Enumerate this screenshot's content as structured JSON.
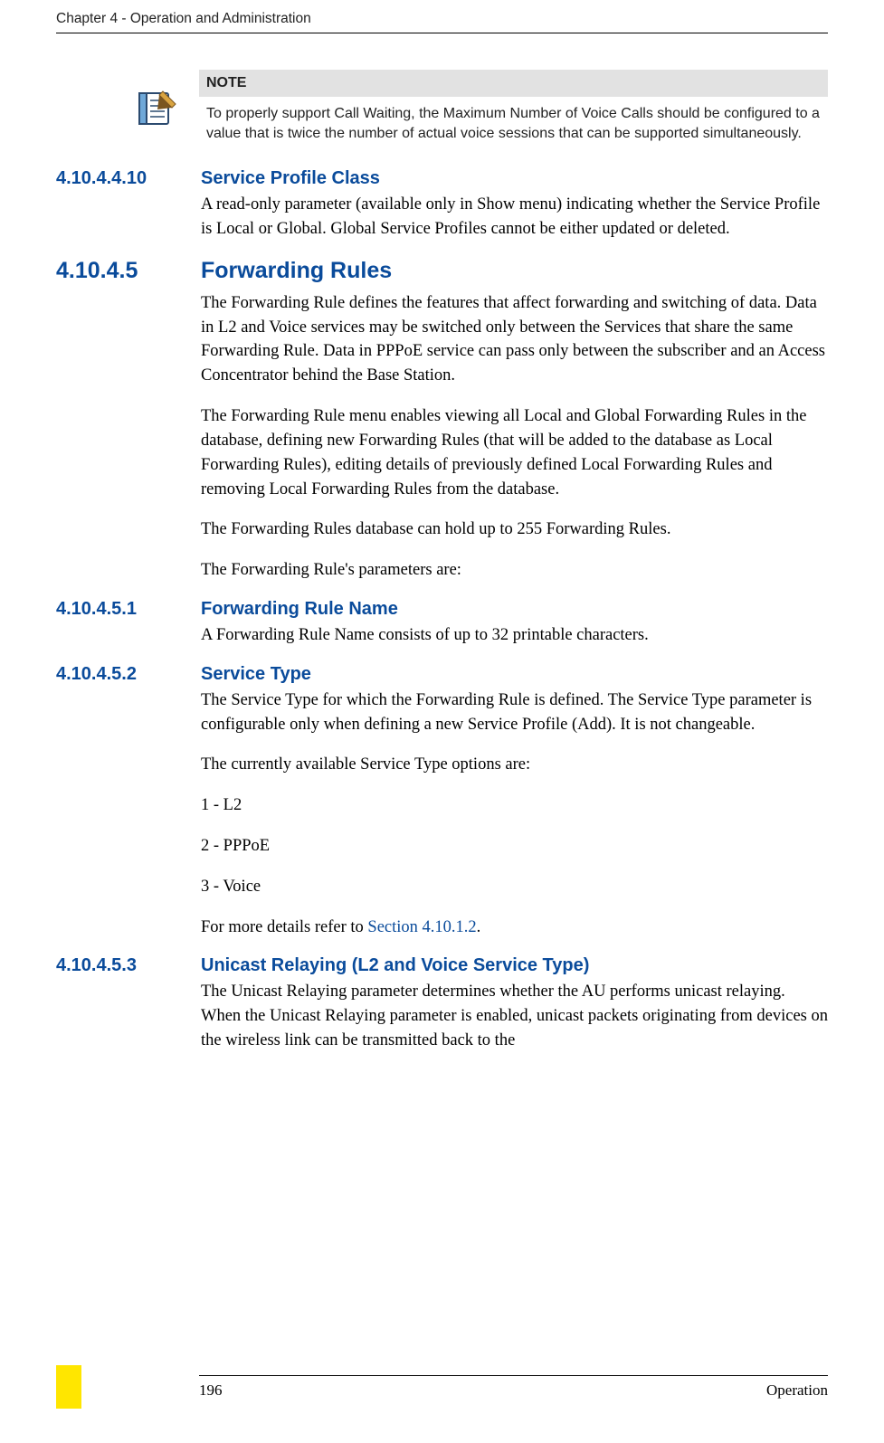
{
  "header": {
    "running": "Chapter 4 - Operation and Administration"
  },
  "note": {
    "title": "NOTE",
    "text": "To properly support Call Waiting, the Maximum Number of Voice Calls should be configured to a value that is twice the number of actual voice sessions that can be supported simultaneously."
  },
  "sections": {
    "s1": {
      "num": "4.10.4.4.10",
      "title": "Service Profile Class",
      "p1": "A read-only parameter (available only in Show menu) indicating whether the Service Profile is Local or Global. Global Service Profiles cannot be either updated or deleted."
    },
    "s2": {
      "num": "4.10.4.5",
      "title": "Forwarding Rules",
      "p1": "The Forwarding Rule defines the features that affect forwarding and switching of data. Data in L2 and Voice services may be switched only between the Services that share the same Forwarding Rule. Data in PPPoE service can pass only between the subscriber and an Access Concentrator behind the Base Station.",
      "p2": "The Forwarding Rule menu enables viewing all Local and Global Forwarding Rules in the database, defining new Forwarding Rules (that will be added to the database as Local Forwarding Rules), editing details of previously defined Local Forwarding Rules and removing Local Forwarding Rules from the database.",
      "p3": "The Forwarding Rules database can hold up to 255 Forwarding Rules.",
      "p4": "The Forwarding Rule's parameters are:"
    },
    "s3": {
      "num": "4.10.4.5.1",
      "title": "Forwarding Rule Name",
      "p1": "A Forwarding Rule Name consists of up to 32 printable characters."
    },
    "s4": {
      "num": "4.10.4.5.2",
      "title": "Service Type",
      "p1": "The Service Type for which the Forwarding Rule is defined. The Service Type parameter is configurable only when defining a new Service Profile (Add). It is not changeable.",
      "p2": "The currently available Service Type options are:",
      "opt1": "1 - L2",
      "opt2": "2 - PPPoE",
      "opt3": "3 - Voice",
      "p3a": "For more details refer to ",
      "p3link": "Section 4.10.1.2",
      "p3b": "."
    },
    "s5": {
      "num": "4.10.4.5.3",
      "title": "Unicast Relaying (L2 and Voice Service Type)",
      "p1": "The Unicast Relaying parameter determines whether the AU performs unicast relaying. When the Unicast Relaying parameter is enabled, unicast packets originating from devices on the wireless link can be transmitted back to the"
    }
  },
  "footer": {
    "page": "196",
    "label": "Operation"
  }
}
